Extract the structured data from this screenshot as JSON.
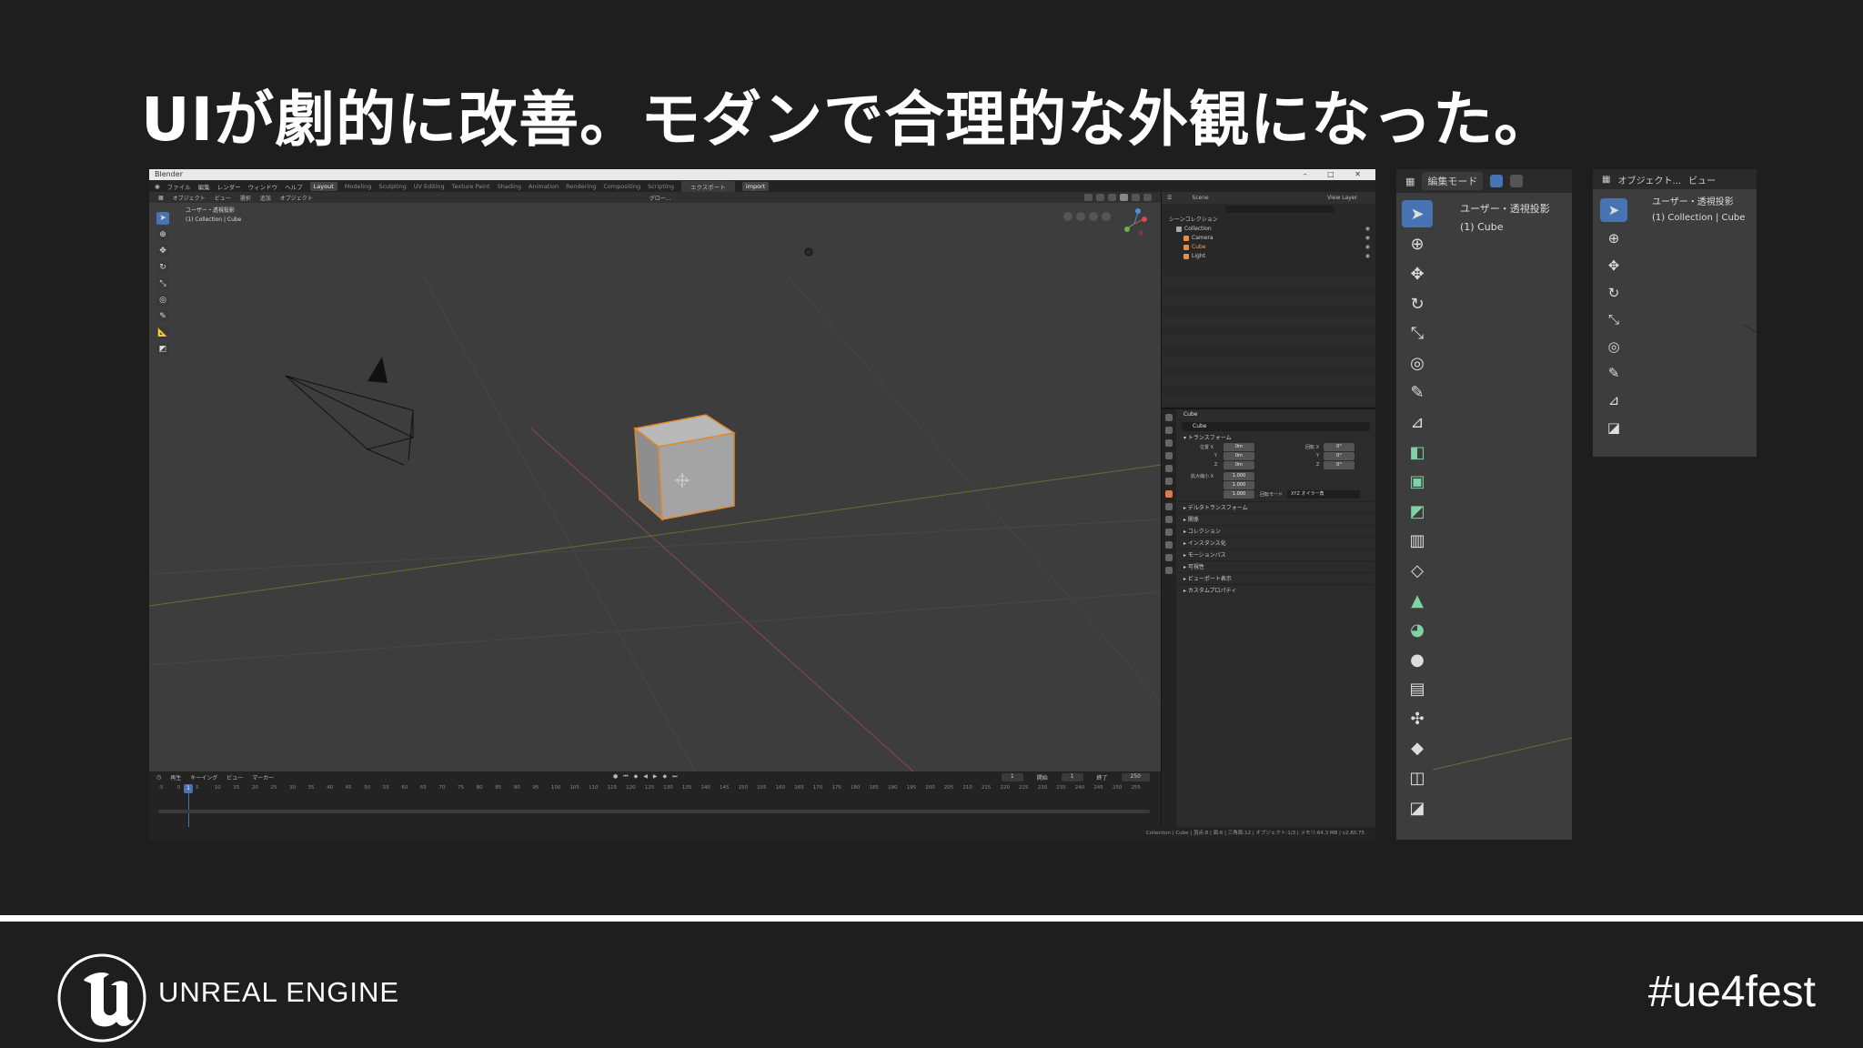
{
  "slide": {
    "title": "UIが劇的に改善。モダンで合理的な外観になった。",
    "hashtag": "#ue4fest",
    "brand": "UNREAL ENGINE"
  },
  "blender": {
    "window_title": "Blender",
    "window_controls": "–  □  ✕",
    "menus": [
      "ファイル",
      "編集",
      "レンダー",
      "ウィンドウ",
      "ヘルプ"
    ],
    "workspaces": [
      "Layout",
      "Modeling",
      "Sculpting",
      "UV Editing",
      "Texture Paint",
      "Shading",
      "Animation",
      "Rendering",
      "Compositing",
      "Scripting"
    ],
    "export_tab": "エクスポート",
    "import_tab": "import",
    "viewport": {
      "mode": "オブジェクト",
      "menus": [
        "ビュー",
        "選択",
        "追加",
        "オブジェクト"
      ],
      "view_name": "ユーザー・透視投影",
      "collection_path": "(1) Collection | Cube",
      "orientation": "グロー..."
    },
    "outliner": {
      "scene": "Scene",
      "view_layer": "View Layer",
      "rows": [
        {
          "label": "シーンコレクション",
          "color": "#ffffff"
        },
        {
          "label": "Collection",
          "color": "#aaaaaa"
        },
        {
          "label": "Camera",
          "color": "#e58d46"
        },
        {
          "label": "Cube",
          "color": "#e58d46"
        },
        {
          "label": "Light",
          "color": "#e58d46"
        }
      ]
    },
    "properties": {
      "object_name": "Cube",
      "name_field": "Cube",
      "transform_section": "トランスフォーム",
      "location_label": "位置 X",
      "rotation_label": "回転 X",
      "scale_label": "拡大縮小 X",
      "rotation_mode_label": "回転モード",
      "rotation_mode_value": "XYZ オイラー角",
      "loc": [
        "0m",
        "0m",
        "0m"
      ],
      "rot": [
        "0°",
        "0°",
        "0°"
      ],
      "scale": [
        "1.000",
        "1.000",
        "1.000"
      ],
      "axes": [
        "Y",
        "Z"
      ],
      "delta_section": "デルタトランスフォーム",
      "sections": [
        "関係",
        "コレクション",
        "インスタンス化",
        "モーションパス",
        "可視性",
        "ビューポート表示",
        "カスタムプロパティ"
      ]
    },
    "timeline": {
      "menus": [
        "再生",
        "キーイング",
        "ビュー",
        "マーカー"
      ],
      "current_frame": "1",
      "start_label": "開始",
      "start": "1",
      "end_label": "終了",
      "end": "250",
      "ruler": [
        "-5",
        "0",
        "5",
        "10",
        "15",
        "20",
        "25",
        "30",
        "35",
        "40",
        "45",
        "50",
        "55",
        "60",
        "65",
        "70",
        "75",
        "80",
        "85",
        "90",
        "95",
        "100",
        "105",
        "110",
        "115",
        "120",
        "125",
        "130",
        "135",
        "140",
        "145",
        "150",
        "155",
        "160",
        "165",
        "170",
        "175",
        "180",
        "185",
        "190",
        "195",
        "200",
        "205",
        "210",
        "215",
        "220",
        "225",
        "230",
        "235",
        "240",
        "245",
        "250",
        "255"
      ]
    },
    "status": "Collection | Cube | 頂点:8 | 面:6 | 三角面:12 | オブジェクト:1/3 | メモリ:64.3 MB | v2.80.75"
  },
  "edit_panel": {
    "mode": "編集モード",
    "view_name": "ユーザー・透視投影",
    "object": "(1) Cube"
  },
  "object_panel": {
    "mode": "オブジェクト...",
    "view_menu": "ビュー",
    "view_name": "ユーザー・透視投影",
    "collection_path": "(1) Collection | Cube"
  }
}
